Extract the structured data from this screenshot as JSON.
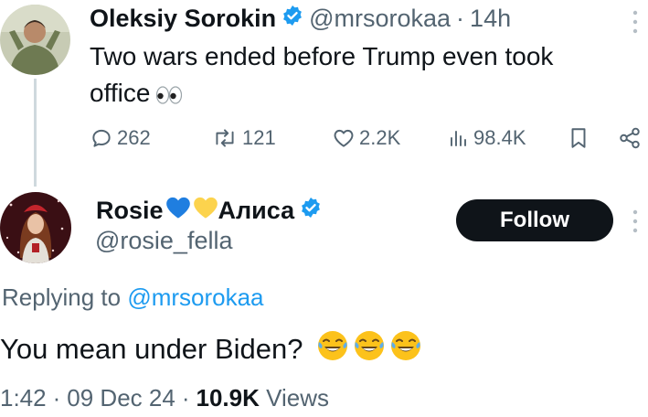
{
  "parent_tweet": {
    "author_name": "Oleksiy Sorokin",
    "handle": "@mrsorokaa",
    "separator": "·",
    "time": "14h",
    "text": "Two wars ended before Trump even took office",
    "emoji": "eyes-emoji",
    "actions": {
      "replies": "262",
      "retweets": "121",
      "likes": "2.2K",
      "views": "98.4K"
    }
  },
  "reply_tweet": {
    "author_name_part1": "Rosie",
    "author_name_part2": "Алиса",
    "name_emojis": [
      "blue-heart-emoji",
      "yellow-heart-emoji"
    ],
    "handle": "@rosie_fella",
    "follow_label": "Follow",
    "replying_prefix": "Replying to",
    "replying_to": "@mrsorokaa",
    "text": "You mean under Biden?",
    "text_emojis": [
      "laughing-tears-emoji",
      "laughing-tears-emoji",
      "laughing-tears-emoji"
    ],
    "time": "1:42",
    "date": "09 Dec 24",
    "separator": "·",
    "views_count": "10.9K",
    "views_label": "Views"
  },
  "colors": {
    "text_primary": "#0f1419",
    "text_secondary": "#536471",
    "accent_blue": "#1d9bf0",
    "follow_button_bg": "#0f1419"
  }
}
